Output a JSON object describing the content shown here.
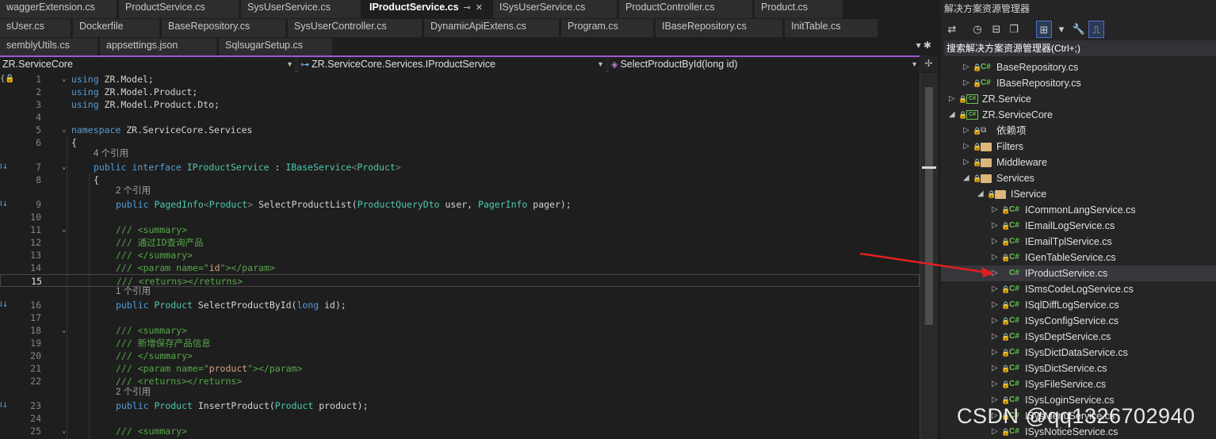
{
  "tabs": {
    "row1": [
      "waggerExtension.cs",
      "ProductService.cs",
      "SysUserService.cs",
      "IProductService.cs",
      "ISysUserService.cs",
      "ProductController.cs",
      "Product.cs"
    ],
    "active": "IProductService.cs",
    "pin": "⊸",
    "close": "✕",
    "row2": [
      "sUser.cs",
      "Dockerfile",
      "BaseRepository.cs",
      "SysUserController.cs",
      "DynamicApiExtens.cs",
      "Program.cs",
      "IBaseRepository.cs",
      "InitTable.cs"
    ],
    "row3": [
      "semblyUtils.cs",
      "appsettings.json",
      "SqlsugarSetup.cs"
    ],
    "row_end_icons": "▾ ✱"
  },
  "navbar": {
    "project": "ZR.ServiceCore",
    "type": "ZR.ServiceCore.Services.IProductService",
    "member": "SelectProductById(long id)"
  },
  "refs": {
    "r4": "4 个引用",
    "r2a": "2 个引用",
    "r1": "1 个引用",
    "r2b": "2 个引用"
  },
  "code": {
    "l1": {
      "kw": "using",
      "rest": " ZR.Model;"
    },
    "l2": {
      "kw": "using",
      "rest": " ZR.Model.Product;"
    },
    "l3": {
      "kw": "using",
      "rest": " ZR.Model.Product.Dto;"
    },
    "l5": {
      "kw": "namespace",
      "rest": " ZR.ServiceCore.Services"
    },
    "l6": "{",
    "l7": {
      "kw": "public interface",
      "name": " IProductService",
      "sep": " : ",
      "base": "IBaseService",
      "lt": "<",
      "arg": "Product",
      "gt": ">"
    },
    "l8": "{",
    "l9": {
      "kw": "public",
      "t1": " PagedInfo",
      "lt": "<",
      "t2": "Product",
      "gt": ">",
      "m": " SelectProductList(",
      "p1": "ProductQueryDto",
      "p1n": " user, ",
      "p2": "PagerInfo",
      "p2n": " pager);"
    },
    "l11": {
      "c": "/// <summary>"
    },
    "l12": {
      "c": "/// 通过ID查询产品"
    },
    "l13": {
      "c": "/// </summary>"
    },
    "l14": {
      "a": "/// <param name=\"",
      "s": "id",
      "b": "\"></param>"
    },
    "l15": {
      "c": "/// <returns></returns>"
    },
    "l16": {
      "kw": "public",
      "t": " Product",
      "m": " SelectProductById(",
      "k2": "long",
      "p": " id);"
    },
    "l18": {
      "c": "/// <summary>"
    },
    "l19": {
      "c": "/// 新增保存产品信息"
    },
    "l20": {
      "c": "/// </summary>"
    },
    "l21": {
      "a": "/// <param name=\"",
      "s": "product",
      "b": "\"></param>"
    },
    "l22": {
      "c": "/// <returns></returns>"
    },
    "l23": {
      "kw": "public",
      "t": " Product",
      "m": " InsertProduct(",
      "t2": "Product",
      "p": " product);"
    },
    "l25": {
      "c": "/// <summary>"
    }
  },
  "line_numbers": [
    "1",
    "2",
    "3",
    "4",
    "5",
    "6",
    "7",
    "8",
    "9",
    "10",
    "11",
    "12",
    "13",
    "14",
    "15",
    "16",
    "17",
    "18",
    "19",
    "20",
    "21",
    "22",
    "23",
    "24",
    "25"
  ],
  "current_line": "15",
  "gutter_glyph": "I↓",
  "split_glyph": "✢",
  "solution": {
    "title": "解决方案资源管理器",
    "search": "搜索解决方案资源管理器(Ctrl+;)",
    "tool_icons": [
      "sync-icon",
      "history-icon",
      "collapse-icon",
      "pages-icon",
      "switch-view-icon",
      "filter-icon",
      "wrench-icon",
      "preview-icon"
    ],
    "items": [
      {
        "name": "BaseRepository.cs",
        "kind": "cs"
      },
      {
        "name": "IBaseRepository.cs",
        "kind": "cs"
      },
      {
        "name": "ZR.Service",
        "kind": "proj"
      },
      {
        "name": "ZR.ServiceCore",
        "kind": "proj"
      },
      {
        "name": "依赖项",
        "kind": "dep"
      },
      {
        "name": "Filters",
        "kind": "folder"
      },
      {
        "name": "Middleware",
        "kind": "folder"
      },
      {
        "name": "Services",
        "kind": "folder"
      },
      {
        "name": "IService",
        "kind": "folder"
      },
      {
        "name": "ICommonLangService.cs",
        "kind": "cs"
      },
      {
        "name": "IEmailLogService.cs",
        "kind": "cs"
      },
      {
        "name": "IEmailTplService.cs",
        "kind": "cs"
      },
      {
        "name": "IGenTableService.cs",
        "kind": "cs"
      },
      {
        "name": "IProductService.cs",
        "kind": "cs"
      },
      {
        "name": "ISmsCodeLogService.cs",
        "kind": "cs"
      },
      {
        "name": "ISqlDiffLogService.cs",
        "kind": "cs"
      },
      {
        "name": "ISysConfigService.cs",
        "kind": "cs"
      },
      {
        "name": "ISysDeptService.cs",
        "kind": "cs"
      },
      {
        "name": "ISysDictDataService.cs",
        "kind": "cs"
      },
      {
        "name": "ISysDictService.cs",
        "kind": "cs"
      },
      {
        "name": "ISysFileService.cs",
        "kind": "cs"
      },
      {
        "name": "ISysLoginService.cs",
        "kind": "cs"
      },
      {
        "name": "ISysMenuService.cs",
        "kind": "cs"
      },
      {
        "name": "ISysNoticeService.cs",
        "kind": "cs"
      }
    ],
    "cs_label": "C#",
    "proj_label": "C#"
  },
  "watermark": "CSDN @qq1326702940",
  "colors": {
    "annotation_arrow": "#e02020",
    "accent": "#9b59d0"
  }
}
